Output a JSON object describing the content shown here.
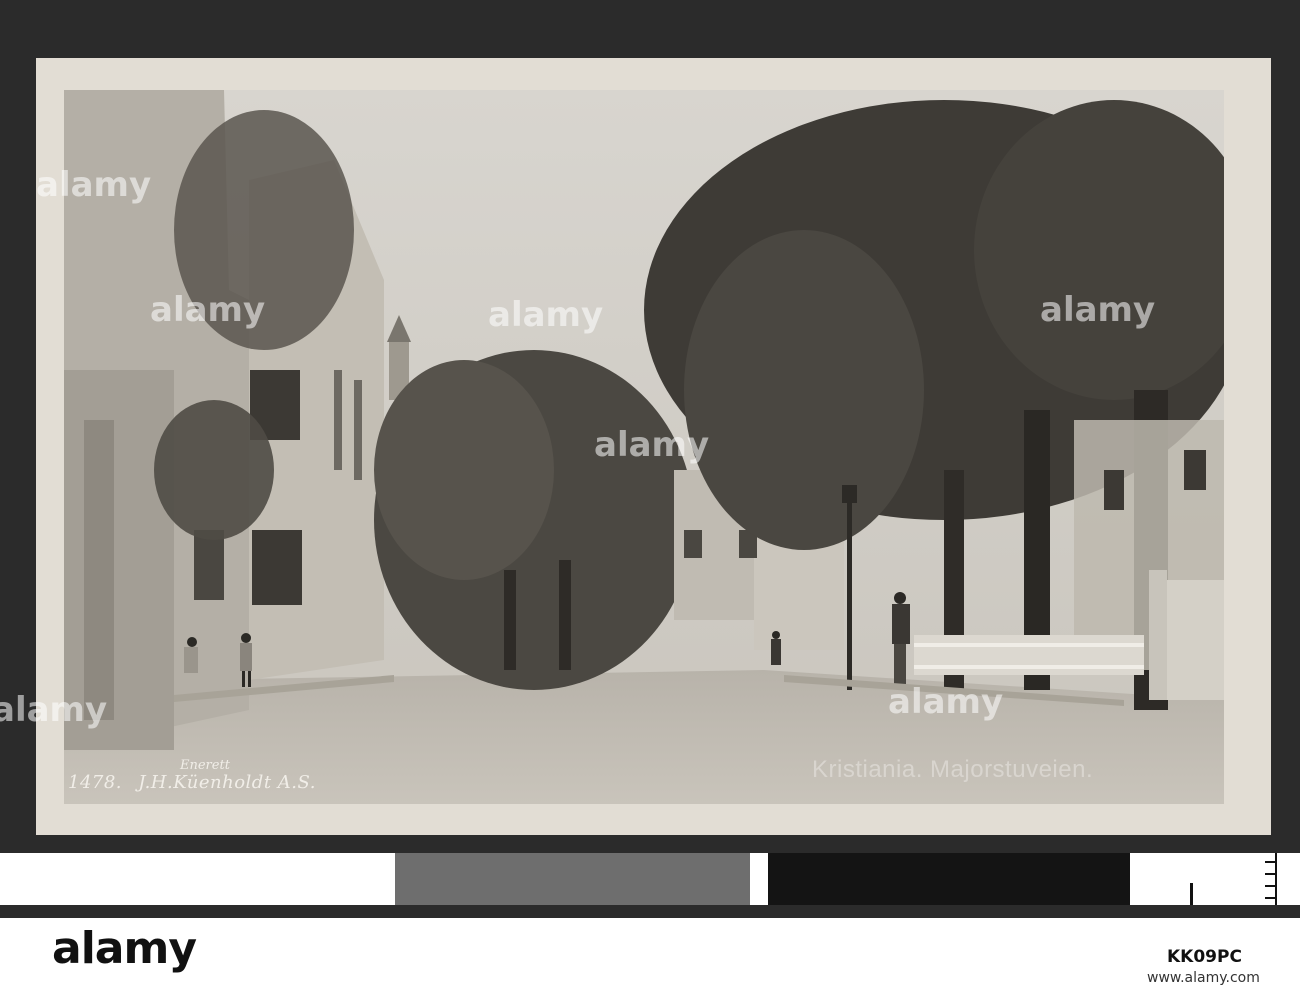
{
  "postcard": {
    "number": "1478.",
    "enerett": "Enerett",
    "publisher": "J.H.Küenholdt A.S.",
    "title": "Kristiania. Majorstuveien."
  },
  "watermark": {
    "text": "alamy"
  },
  "footer": {
    "logo": "alamy",
    "image_id": "KK09PC",
    "site": "www.alamy.com"
  },
  "colors": {
    "mount": "#2b2b2b",
    "card": "#e2ddd4",
    "photo_tone": "#8c877e"
  }
}
